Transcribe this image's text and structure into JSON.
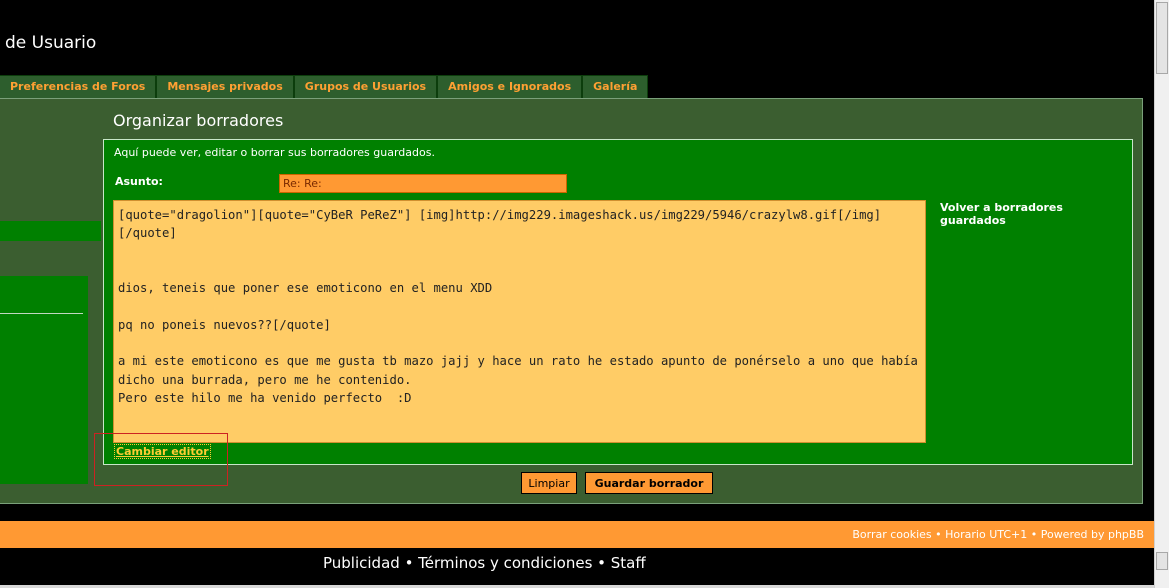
{
  "header": {
    "title": "de Usuario"
  },
  "tabs": [
    {
      "label": "Preferencias de Foros"
    },
    {
      "label": "Mensajes privados"
    },
    {
      "label": "Grupos de Usuarios"
    },
    {
      "label": "Amigos e Ignorados"
    },
    {
      "label": "Galería"
    }
  ],
  "main": {
    "title": "Organizar borradores",
    "intro": "Aquí puede ver, editar o borrar sus borradores guardados.",
    "subject_label": "Asunto:",
    "subject_value": "Re: Re:",
    "editor_text": "[quote=\"dragolion\"][quote=\"CyBeR PeReZ\"] [img]http://img229.imageshack.us/img229/5946/crazylw8.gif[/img] [/quote]\n\n\ndios, teneis que poner ese emoticono en el menu XDD\n\npq no poneis nuevos??[/quote]\n\na mi este emoticono es que me gusta tb mazo jajj y hace un rato he estado apunto de ponérselo a uno que había dicho una burrada, pero me he contenido.\nPero este hilo me ha venido perfecto  :D",
    "back_link": "Volver a borradores guardados",
    "change_editor": "Cambiar editor",
    "clear_button": "Limpiar",
    "save_button": "Guardar borrador"
  },
  "footer": {
    "text": "Borrar cookies • Horario UTC+1 • Powered by phpBB",
    "bottom_links": "Publicidad • Términos y condiciones • Staff"
  },
  "colors": {
    "accent": "#ff9933",
    "panel": "#3b5e30",
    "inner": "#008000",
    "editor_bg": "#ffcc66"
  }
}
